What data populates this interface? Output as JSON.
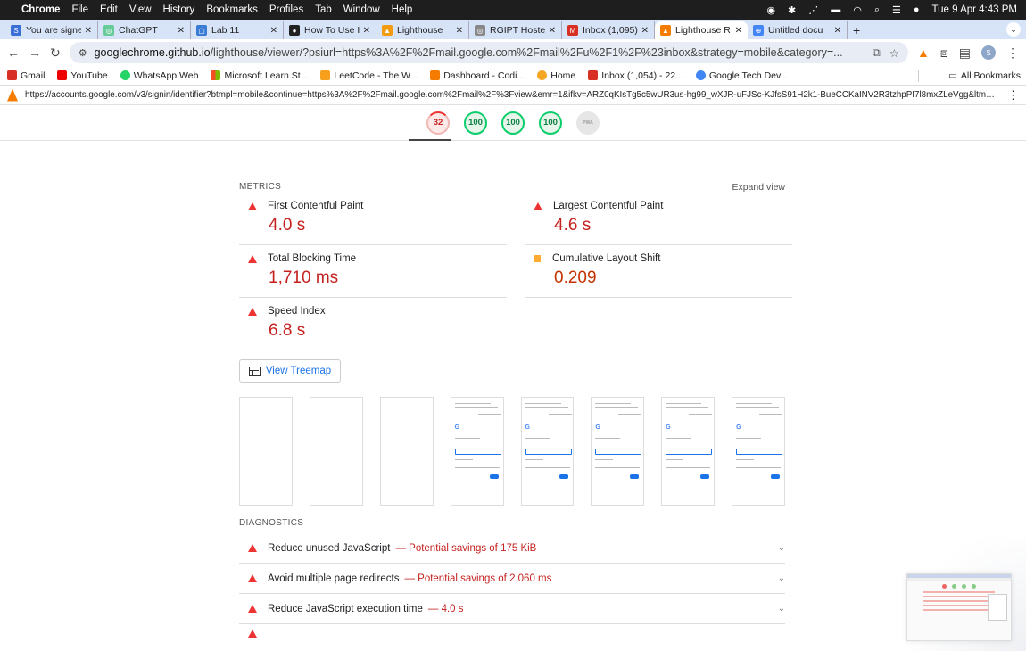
{
  "menubar": {
    "app": "Chrome",
    "items": [
      "File",
      "Edit",
      "View",
      "History",
      "Bookmarks",
      "Profiles",
      "Tab",
      "Window",
      "Help"
    ],
    "datetime": "Tue 9 Apr  4:43 PM"
  },
  "tabs": [
    {
      "label": "You are signe",
      "color": "#3b6fd8",
      "glyph": "S"
    },
    {
      "label": "ChatGPT",
      "color": "#6c9",
      "glyph": "◎"
    },
    {
      "label": "Lab 11",
      "color": "#3a7bd5",
      "glyph": "▢"
    },
    {
      "label": "How To Use I",
      "color": "#222",
      "glyph": "●"
    },
    {
      "label": "Lighthouse",
      "color": "#f39c12",
      "glyph": "▲"
    },
    {
      "label": "RGIPT Hoste",
      "color": "#888",
      "glyph": "◎"
    },
    {
      "label": "Inbox (1,095)",
      "color": "#d93025",
      "glyph": "M"
    },
    {
      "label": "Lighthouse R",
      "color": "#f57c00",
      "glyph": "▲",
      "active": true
    },
    {
      "label": "Untitled docu",
      "color": "#4285f4",
      "glyph": "⊕"
    }
  ],
  "omnibox": {
    "domain": "googlechrome.github.io",
    "path": "/lighthouse/viewer/?psiurl=https%3A%2F%2Fmail.google.com%2Fmail%2Fu%2F1%2F%23inbox&strategy=mobile&category=..."
  },
  "bookmarks": [
    {
      "label": "Gmail",
      "color": "#d93025"
    },
    {
      "label": "YouTube",
      "color": "#e00"
    },
    {
      "label": "WhatsApp Web",
      "color": "#25d366"
    },
    {
      "label": "Microsoft Learn St...",
      "color": "#f25022"
    },
    {
      "label": "LeetCode - The W...",
      "color": "#f89f1b"
    },
    {
      "label": "Dashboard - Codi...",
      "color": "#f57c00"
    },
    {
      "label": "Home",
      "color": "#f5a623"
    },
    {
      "label": "Inbox (1,054) - 22...",
      "color": "#d93025"
    },
    {
      "label": "Google Tech Dev...",
      "color": "#4285f4"
    }
  ],
  "all_bookmarks": "All Bookmarks",
  "report_url": "https://accounts.google.com/v3/signin/identifier?btmpl=mobile&continue=https%3A%2F%2Fmail.google.com%2Fmail%2F%3Fview&emr=1&ifkv=ARZ0qKIsTg5c5wUR3us-hg99_wXJR-uFJSc-KJfsS91H2k1-BueCCKaINV2R3tzhpPI7l8mxZLeVgg&ltmpl...",
  "scores": [
    {
      "value": "32",
      "status": "red"
    },
    {
      "value": "100",
      "status": "green"
    },
    {
      "value": "100",
      "status": "green"
    },
    {
      "value": "100",
      "status": "green"
    },
    {
      "value": "PWA",
      "status": "gray"
    }
  ],
  "metrics": {
    "heading": "METRICS",
    "expand": "Expand view",
    "items": [
      {
        "label": "First Contentful Paint",
        "value": "4.0 s",
        "level": "red"
      },
      {
        "label": "Largest Contentful Paint",
        "value": "4.6 s",
        "level": "red"
      },
      {
        "label": "Total Blocking Time",
        "value": "1,710 ms",
        "level": "red"
      },
      {
        "label": "Cumulative Layout Shift",
        "value": "0.209",
        "level": "orange"
      },
      {
        "label": "Speed Index",
        "value": "6.8 s",
        "level": "red"
      }
    ]
  },
  "treemap_label": "View Treemap",
  "diagnostics": {
    "heading": "DIAGNOSTICS",
    "items": [
      {
        "label": "Reduce unused JavaScript",
        "savings": "— Potential savings of 175 KiB"
      },
      {
        "label": "Avoid multiple page redirects",
        "savings": "— Potential savings of 2,060 ms"
      },
      {
        "label": "Reduce JavaScript execution time",
        "savings": "— 4.0 s"
      }
    ]
  }
}
